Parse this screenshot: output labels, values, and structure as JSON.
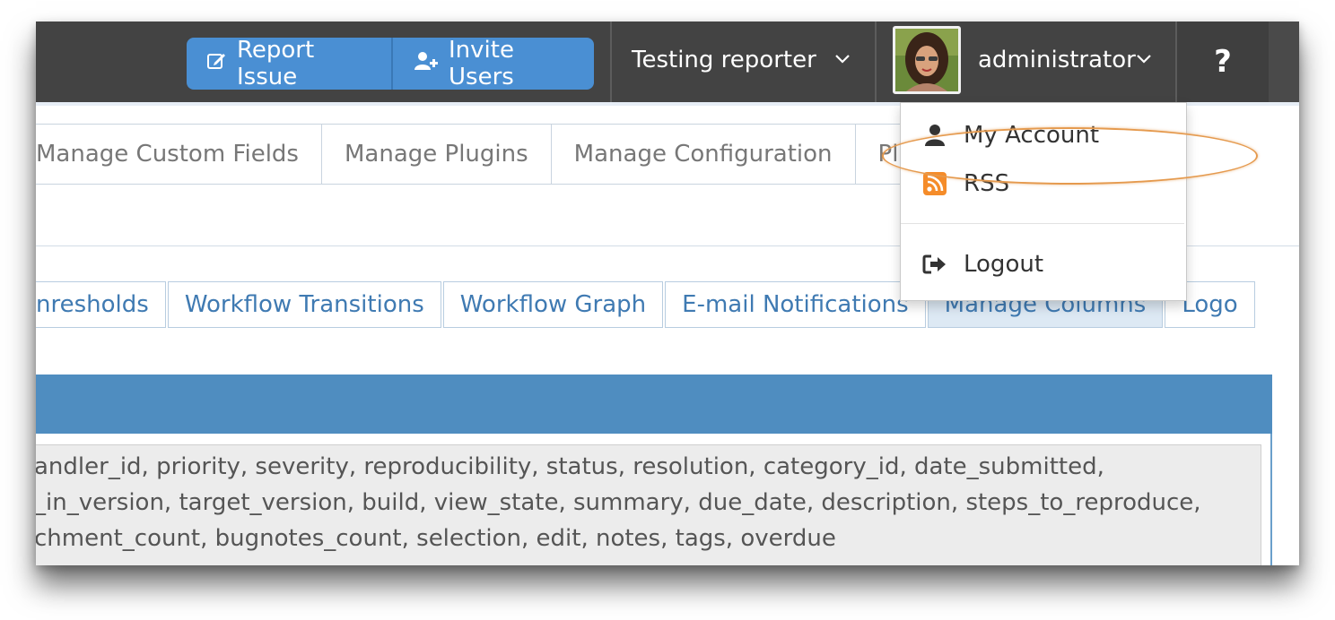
{
  "navbar": {
    "report_issue": "Report Issue",
    "invite_users": "Invite Users",
    "project": "Testing reporter",
    "user": "administrator",
    "help": "?"
  },
  "manage_tabs": [
    "Manage Custom Fields",
    "Manage Plugins",
    "Manage Configuration",
    "Plan"
  ],
  "config_tabs": [
    {
      "label": "nresholds",
      "active": false
    },
    {
      "label": "Workflow Transitions",
      "active": false
    },
    {
      "label": "Workflow Graph",
      "active": false
    },
    {
      "label": "E-mail Notifications",
      "active": false
    },
    {
      "label": "Manage Columns",
      "active": true
    },
    {
      "label": "Logo",
      "active": false
    }
  ],
  "columns_text": [
    "andler_id, priority, severity, reproducibility, status, resolution, category_id, date_submitted,",
    "_in_version, target_version, build, view_state, summary, due_date, description, steps_to_reproduce,",
    "chment_count, bugnotes_count, selection, edit, notes, tags, overdue"
  ],
  "user_menu": {
    "my_account": "My Account",
    "rss": "RSS",
    "logout": "Logout"
  },
  "colors": {
    "navbar": "#434343",
    "primary_button": "#4a8fd3",
    "panel_header": "#4f8dc0",
    "highlight": "#e59a4e",
    "rss": "#f58c2a"
  }
}
